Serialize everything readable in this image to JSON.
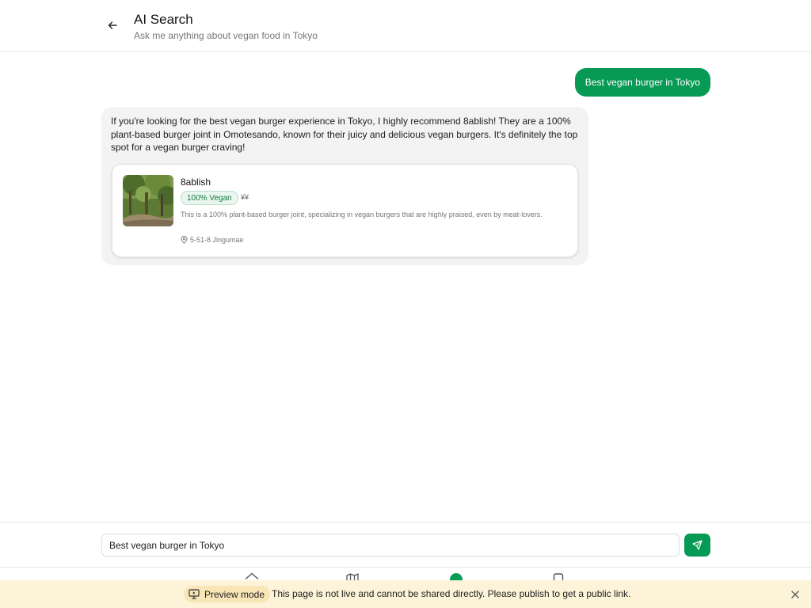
{
  "header": {
    "title": "AI Search",
    "subtitle": "Ask me anything about vegan food in Tokyo"
  },
  "conversation": {
    "user_message": "Best vegan burger in Tokyo",
    "ai_message": "If you're looking for the best vegan burger experience in Tokyo, I highly recommend 8ablish! They are a 100% plant-based burger joint in Omotesando, known for their juicy and delicious vegan burgers. It's definitely the top spot for a vegan burger craving!",
    "restaurant_card": {
      "name": "8ablish",
      "badge": "100% Vegan",
      "price": "¥¥",
      "description": "This is a 100% plant-based burger joint, specializing in vegan burgers that are highly praised, even by meat-lovers.",
      "address": "5-51-8 Jingumae"
    }
  },
  "input": {
    "value": "Best vegan burger in Tokyo"
  },
  "bottom_nav": {
    "icons": [
      "home-icon",
      "map-icon",
      "ai-search-icon",
      "bookmark-icon"
    ],
    "active_index": 2
  },
  "preview_banner": {
    "label": "Preview mode",
    "message": "This page is not live and cannot be shared directly. Please publish to get a public link."
  },
  "colors": {
    "accent": "#079a54",
    "banner_bg": "#fdf3d8",
    "badge_bg": "#eaf6ef"
  }
}
